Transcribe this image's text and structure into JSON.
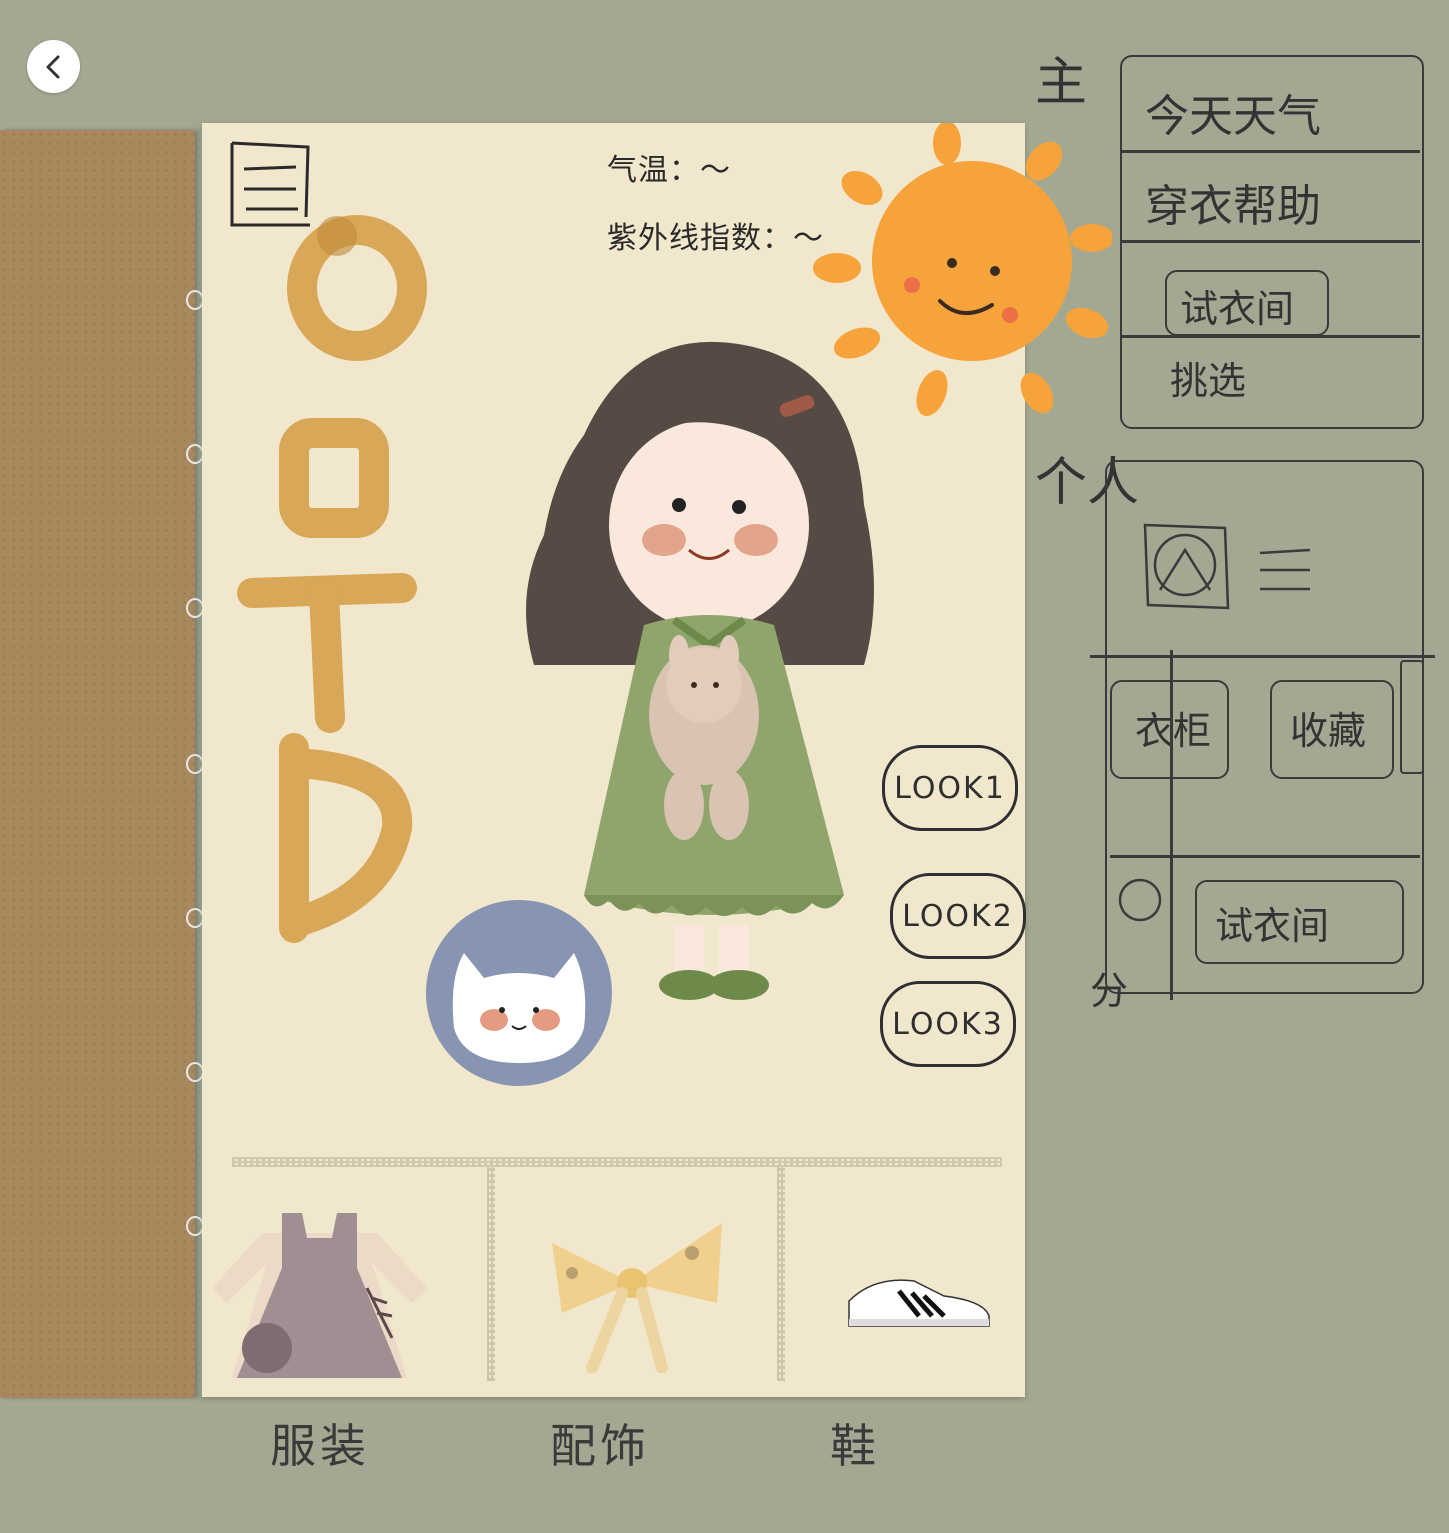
{
  "weather": {
    "temperature_label": "气温：～",
    "uv_label": "紫外线指数：～"
  },
  "title_letters": [
    "O",
    "O",
    "T",
    "D"
  ],
  "looks": [
    "LOOK1",
    "LOOK2",
    "LOOK3"
  ],
  "categories": [
    "服装",
    "配饰",
    "鞋"
  ],
  "sketch": {
    "main_label": "主",
    "today_weather": "今天天气",
    "outfit_tips": "穿衣帮助",
    "fitting_room": "试衣间",
    "shopping": "挑选",
    "personal_label": "个人",
    "closet": "衣柜",
    "collection": "收藏",
    "fitting_room_2": "试衣间",
    "find": "分"
  },
  "colors": {
    "background": "#a3a893",
    "paper": "#f1e7cd",
    "ootd": "#d6a24d",
    "sun": "#f6a33b",
    "dress": "#8fa56b"
  }
}
